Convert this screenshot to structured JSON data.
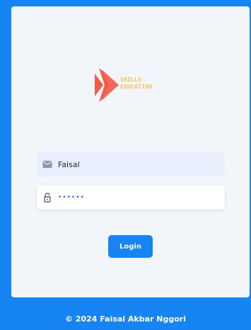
{
  "brand": {
    "line1": "SKILLS",
    "line2": "EDUCATION",
    "logo_icon": "play-chevron-logo-icon"
  },
  "form": {
    "username": {
      "value": "Faisal",
      "icon": "envelope-icon"
    },
    "password": {
      "value": "••••••",
      "icon": "lock-icon"
    },
    "login_label": "Login"
  },
  "footer": {
    "text": "© 2024 Faisal Akbar Nggori"
  },
  "colors": {
    "primary": "#1685f3",
    "card_background": "#f2f5f9",
    "logo_red": "#f25a4a",
    "logo_yellow": "#f6c24a",
    "username_field_background": "#e8eefc"
  }
}
